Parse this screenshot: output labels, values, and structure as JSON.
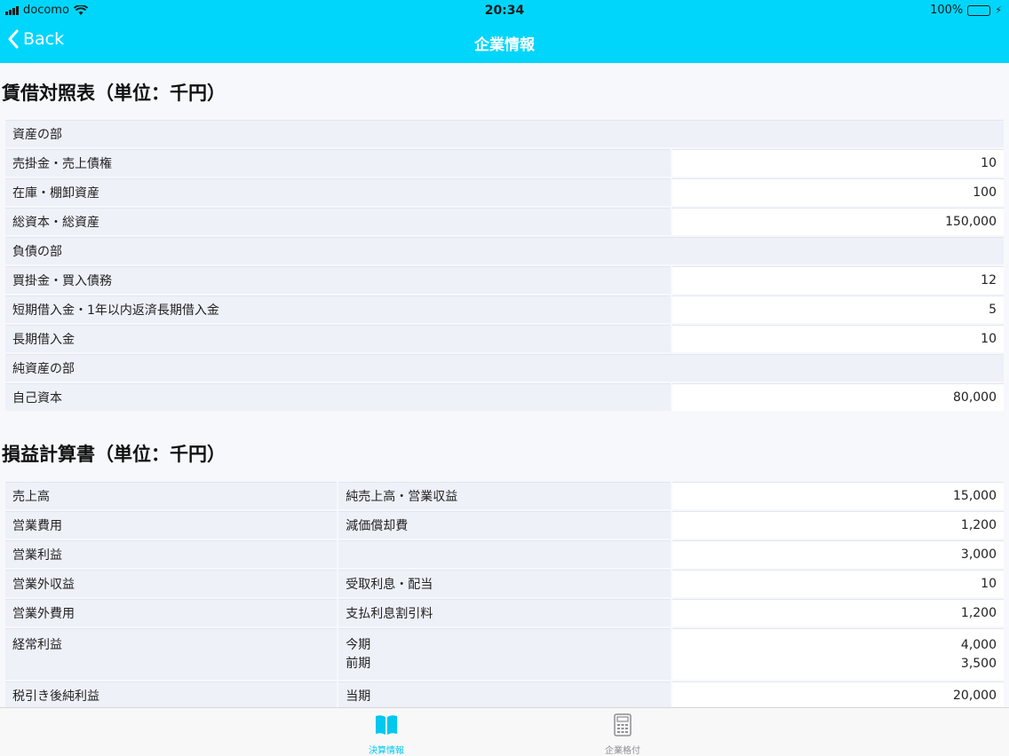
{
  "status_bar": {
    "carrier": "docomo",
    "time": "20:34",
    "battery": "100%"
  },
  "nav": {
    "back_label": "Back",
    "title": "企業情報"
  },
  "balance_sheet": {
    "title": "賃借対照表（単位：千円）",
    "rows": [
      {
        "type": "header",
        "label": "資産の部"
      },
      {
        "type": "item",
        "label": "売掛金・売上債権",
        "value": "10"
      },
      {
        "type": "item",
        "label": "在庫・棚卸資産",
        "value": "100"
      },
      {
        "type": "item",
        "label": "総資本・総資産",
        "value": "150,000"
      },
      {
        "type": "header",
        "label": "負債の部"
      },
      {
        "type": "item",
        "label": "買掛金・買入債務",
        "value": "12"
      },
      {
        "type": "item",
        "label": "短期借入金・1年以内返済長期借入金",
        "value": "5"
      },
      {
        "type": "item",
        "label": "長期借入金",
        "value": "10"
      },
      {
        "type": "header",
        "label": "純資産の部"
      },
      {
        "type": "item",
        "label": "自己資本",
        "value": "80,000"
      }
    ]
  },
  "income_statement": {
    "title": "損益計算書（単位：千円）",
    "rows": [
      {
        "label": "売上高",
        "sub": "純売上高・営業収益",
        "value": "15,000"
      },
      {
        "label": "営業費用",
        "sub": "減価償却費",
        "value": "1,200"
      },
      {
        "label": "営業利益",
        "sub": "",
        "value": "3,000"
      },
      {
        "label": "営業外収益",
        "sub": "受取利息・配当",
        "value": "10"
      },
      {
        "label": "営業外費用",
        "sub": "支払利息割引料",
        "value": "1,200"
      },
      {
        "label": "経常利益",
        "sub_lines": [
          "今期",
          "前期"
        ],
        "value_lines": [
          "4,000",
          "3,500"
        ]
      },
      {
        "label": "税引き後純利益",
        "sub": "当期",
        "value": "20,000"
      }
    ]
  },
  "tabbar": {
    "tabs": [
      {
        "label": "決算情報",
        "icon": "book-icon",
        "active": true
      },
      {
        "label": "企業格付",
        "icon": "calculator-icon",
        "active": false
      }
    ]
  },
  "colors": {
    "accent": "#00d6fb",
    "active_tab": "#00c8ee",
    "cell_bg": "#eef1f8",
    "value_bg": "#ffffff"
  }
}
